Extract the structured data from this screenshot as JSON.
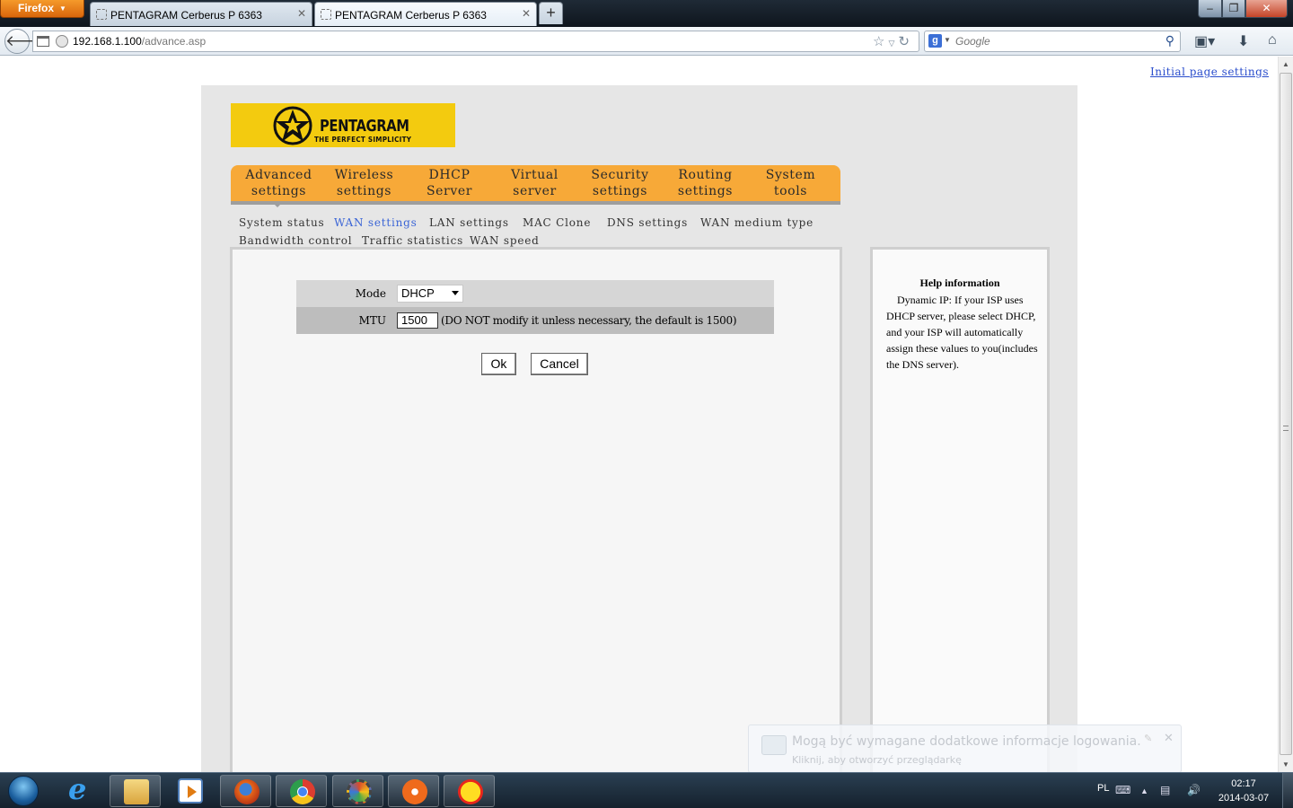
{
  "browser": {
    "app_menu_label": "Firefox",
    "tabs": [
      {
        "title": "PENTAGRAM Cerberus P 6363",
        "active": false
      },
      {
        "title": "PENTAGRAM Cerberus P 6363",
        "active": true
      }
    ],
    "new_tab_label": "+",
    "url_host": "192.168.1.100",
    "url_path": "/advance.asp",
    "search_placeholder": "Google",
    "window_buttons": {
      "minimize": "–",
      "maximize": "❐",
      "close": "✕"
    }
  },
  "page": {
    "top_link": "Initial page settings",
    "logo": {
      "name": "PENTAGRAM",
      "tagline": "THE PERFECT SIMPLICITY",
      "bg_color": "#f3cb0f"
    },
    "main_menu": [
      {
        "line1": "Advanced",
        "line2": "settings"
      },
      {
        "line1": "Wireless",
        "line2": "settings"
      },
      {
        "line1": "DHCP",
        "line2": "Server"
      },
      {
        "line1": "Virtual",
        "line2": "server"
      },
      {
        "line1": "Security",
        "line2": "settings"
      },
      {
        "line1": "Routing",
        "line2": "settings"
      },
      {
        "line1": "System",
        "line2": "tools"
      }
    ],
    "menu_color": "#f7a938",
    "sub_menu": [
      {
        "label": "System status",
        "active": false
      },
      {
        "label": "WAN settings",
        "active": true
      },
      {
        "label": "LAN settings",
        "active": false
      },
      {
        "label": "MAC Clone",
        "active": false
      },
      {
        "label": "DNS settings",
        "active": false
      },
      {
        "label": "WAN medium type",
        "active": false
      },
      {
        "label": "Bandwidth control",
        "active": false
      },
      {
        "label": "Traffic statistics",
        "active": false
      },
      {
        "label": "WAN speed",
        "active": false
      }
    ],
    "form": {
      "mode_label": "Mode",
      "mode_value": "DHCP",
      "mtu_label": "MTU",
      "mtu_value": "1500",
      "mtu_note": "(DO NOT modify it unless necessary, the default is 1500)",
      "ok_label": "Ok",
      "cancel_label": "Cancel"
    },
    "help": {
      "title": "Help information",
      "text": "Dynamic IP: If your ISP uses DHCP server, please select DHCP, and your ISP will automatically assign these values to you(includes the DNS server)."
    },
    "notification": {
      "title": "Mogą być wymagane dodatkowe informacje logowania.",
      "subtitle": "Kliknij, aby otworzyć przeglądarkę"
    }
  },
  "taskbar": {
    "apps": [
      "internet-explorer",
      "windows-explorer",
      "media-player",
      "firefox",
      "chrome",
      "system-tool",
      "orange-app",
      "sun-app"
    ],
    "language": "PL",
    "time": "02:17",
    "date": "2014-03-07"
  }
}
